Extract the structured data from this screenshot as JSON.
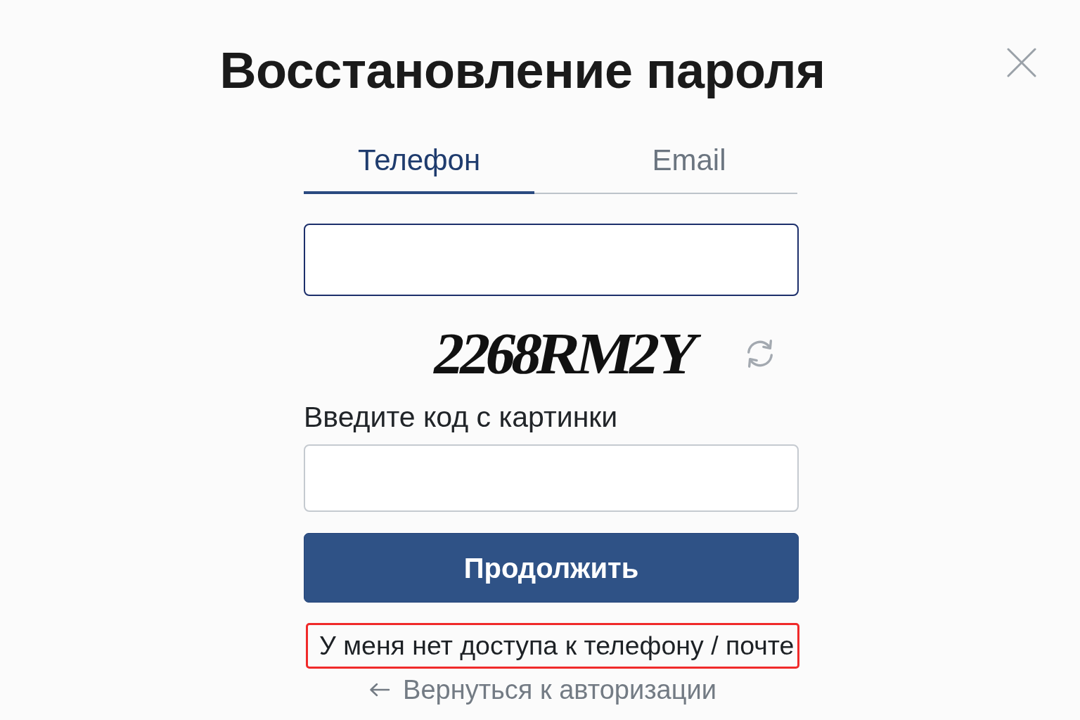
{
  "dialog": {
    "title": "Восстановление пароля"
  },
  "tabs": [
    {
      "label": "Телефон",
      "selected": true
    },
    {
      "label": "Email",
      "selected": false
    }
  ],
  "contact_field": {
    "focused": true
  },
  "captcha": {
    "code": "2268RM2Y"
  },
  "captcha_field": {
    "label": "Введите код с картинки",
    "focused": false
  },
  "submit_button": {
    "label": "Продолжить"
  },
  "no_access_link": {
    "label": "У меня нет доступа к телефону / почте",
    "highlighted": true
  },
  "back_link": {
    "label": "Вернуться к авторизации"
  }
}
